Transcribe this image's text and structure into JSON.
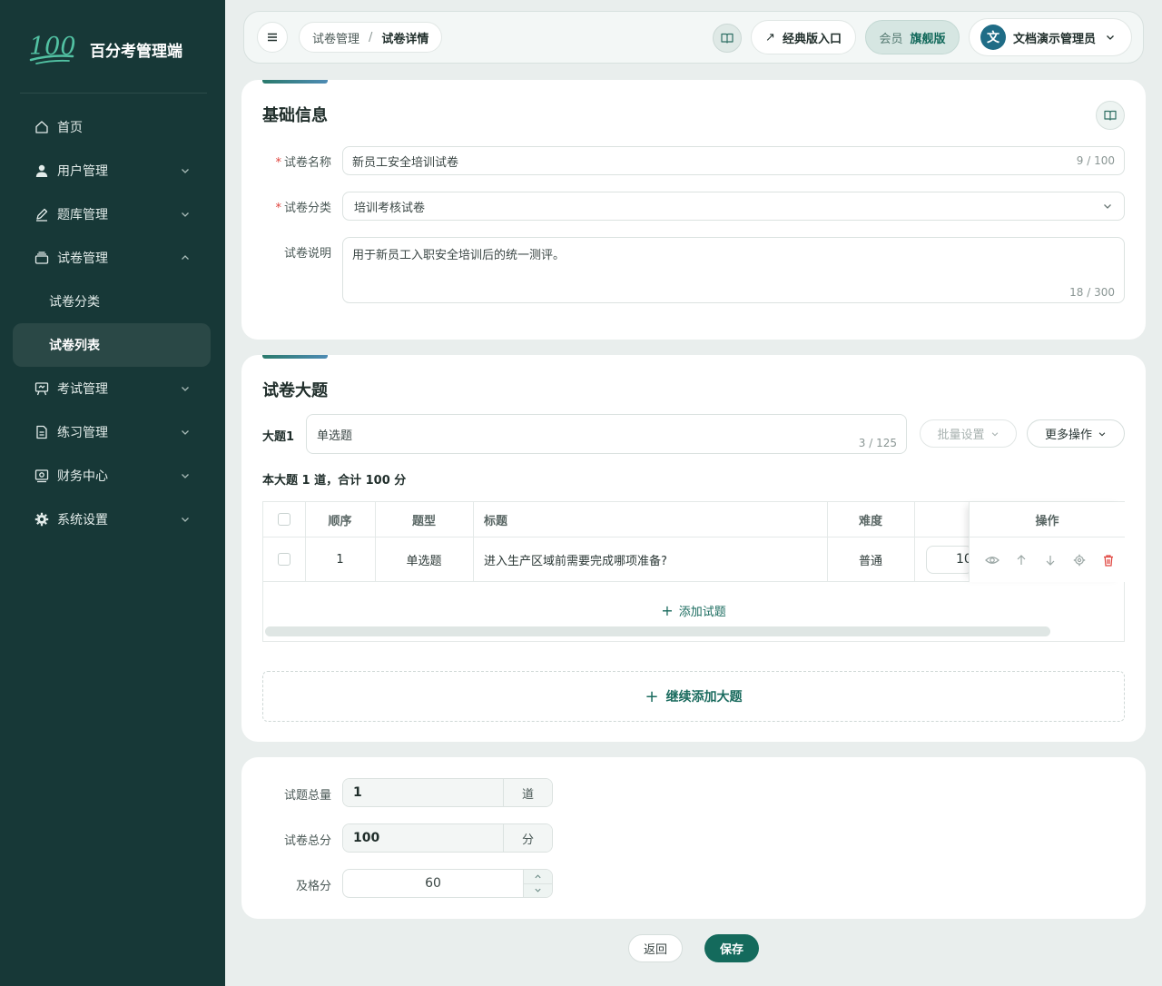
{
  "app": {
    "logo_text": "百分考管理端",
    "logo_mark": "100"
  },
  "sidebar": {
    "items": [
      {
        "label": "首页",
        "icon": "home-icon"
      },
      {
        "label": "用户管理",
        "icon": "user-icon"
      },
      {
        "label": "题库管理",
        "icon": "pen-icon"
      },
      {
        "label": "试卷管理",
        "icon": "stack-icon"
      },
      {
        "label": "试卷分类"
      },
      {
        "label": "试卷列表"
      },
      {
        "label": "考试管理",
        "icon": "presentation-icon"
      },
      {
        "label": "练习管理",
        "icon": "document-icon"
      },
      {
        "label": "财务中心",
        "icon": "finance-icon"
      },
      {
        "label": "系统设置",
        "icon": "gear-icon"
      }
    ]
  },
  "header": {
    "breadcrumb": [
      "试卷管理",
      "试卷详情"
    ],
    "breadcrumb_sep": "/",
    "classic_entry": "经典版入口",
    "vip_label": "会员",
    "vip_edition": "旗舰版",
    "user_initial": "文",
    "user_name": "文档演示管理员"
  },
  "basic": {
    "title": "基础信息",
    "name_label": "试卷名称",
    "name_value": "新员工安全培训试卷",
    "name_count": "9 / 100",
    "category_label": "试卷分类",
    "category_value": "培训考核试卷",
    "desc_label": "试卷说明",
    "desc_value": "用于新员工入职安全培训后的统一测评。",
    "desc_count": "18 / 300"
  },
  "sections": {
    "title": "试卷大题",
    "section_label": "大题1",
    "section_name": "单选题",
    "section_count": "3 / 125",
    "batch_settings": "批量设置",
    "more_actions": "更多操作",
    "summary": "本大题 1 道，合计 100 分",
    "table": {
      "headers": {
        "order": "顺序",
        "type": "题型",
        "title": "标题",
        "difficulty": "难度",
        "ops": "操作"
      },
      "rows": [
        {
          "order": "1",
          "type": "单选题",
          "title": "进入生产区域前需要完成哪项准备?",
          "difficulty": "普通",
          "score": "10"
        }
      ]
    },
    "add_question": "添加试题",
    "add_section": "继续添加大题"
  },
  "totals": {
    "count_label": "试题总量",
    "count_value": "1",
    "count_unit": "道",
    "score_label": "试卷总分",
    "score_value": "100",
    "score_unit": "分",
    "pass_label": "及格分",
    "pass_value": "60"
  },
  "footer": {
    "back": "返回",
    "save": "保存"
  },
  "colors": {
    "sidebar": "#173837",
    "accent": "#146a5c",
    "danger": "#e0443e"
  }
}
